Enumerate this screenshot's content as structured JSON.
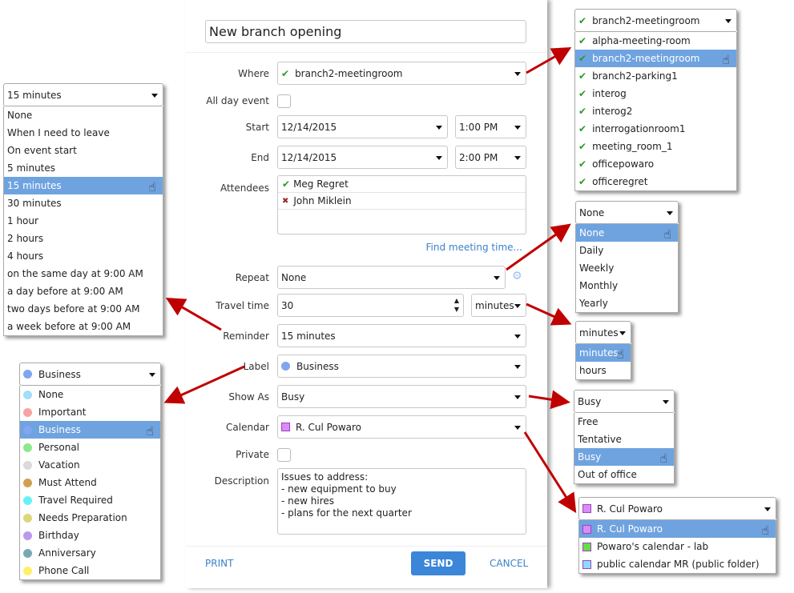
{
  "form": {
    "title": "New branch opening",
    "where_label": "Where",
    "where_value": "branch2-meetingroom",
    "allday_label": "All day event",
    "start_label": "Start",
    "start_date": "12/14/2015",
    "start_time": "1:00 PM",
    "end_label": "End",
    "end_date": "12/14/2015",
    "end_time": "2:00 PM",
    "attendees_label": "Attendees",
    "attendees": [
      {
        "name": "Meg Regret",
        "status": "accepted"
      },
      {
        "name": "John Miklein",
        "status": "declined"
      }
    ],
    "find_meeting_time": "Find meeting time...",
    "repeat_label": "Repeat",
    "repeat_value": "None",
    "travel_label": "Travel time",
    "travel_value": "30",
    "travel_unit": "minutes",
    "reminder_label": "Reminder",
    "reminder_value": "15 minutes",
    "label_label": "Label",
    "label_value": "Business",
    "showas_label": "Show As",
    "showas_value": "Busy",
    "calendar_label": "Calendar",
    "calendar_value": "R. Cul Powaro",
    "private_label": "Private",
    "description_label": "Description",
    "description_lines": [
      "Issues to address:",
      "- new equipment to buy",
      "- new hires",
      "- plans for the next quarter"
    ],
    "print": "PRINT",
    "send": "SEND",
    "cancel": "CANCEL"
  },
  "colors": {
    "accent": "#3b86d8",
    "selected": "#6fa3e0",
    "arrow": "#c00000",
    "check": "#2a9a2a",
    "decline": "#9a2a2a"
  },
  "dropdowns": {
    "where": {
      "value": "branch2-meetingroom",
      "selected": 1,
      "icon": "check",
      "items": [
        "alpha-meeting-room",
        "branch2-meetingroom",
        "branch2-parking1",
        "interog",
        "interog2",
        "interrogationroom1",
        "meeting_room_1",
        "officepowaro",
        "officeregret"
      ]
    },
    "reminder": {
      "value": "15 minutes",
      "selected": 4,
      "items": [
        "None",
        "When I need to leave",
        "On event start",
        "5 minutes",
        "15 minutes",
        "30 minutes",
        "1 hour",
        "2 hours",
        "4 hours",
        "on the same day at 9:00 AM",
        "a day before at 9:00 AM",
        "two days before at 9:00 AM",
        "a week before at 9:00 AM"
      ]
    },
    "repeat": {
      "value": "None",
      "selected": 0,
      "items": [
        "None",
        "Daily",
        "Weekly",
        "Monthly",
        "Yearly"
      ]
    },
    "travel_unit": {
      "value": "minutes",
      "selected": 0,
      "items": [
        "minutes",
        "hours"
      ]
    },
    "showas": {
      "value": "Busy",
      "selected": 2,
      "items": [
        "Free",
        "Tentative",
        "Busy",
        "Out of office"
      ]
    },
    "label": {
      "value": "Business",
      "value_color": "#7fa6ee",
      "selected": 2,
      "icon": "dot",
      "items": [
        {
          "text": "None",
          "color": "#a3def8"
        },
        {
          "text": "Important",
          "color": "#f7a3a3"
        },
        {
          "text": "Business",
          "color": "#7fa6ee"
        },
        {
          "text": "Personal",
          "color": "#8ee88e"
        },
        {
          "text": "Vacation",
          "color": "#dadada"
        },
        {
          "text": "Must Attend",
          "color": "#d0a050"
        },
        {
          "text": "Travel Required",
          "color": "#66f2f4"
        },
        {
          "text": "Needs Preparation",
          "color": "#dcd77a"
        },
        {
          "text": "Birthday",
          "color": "#bb99ee"
        },
        {
          "text": "Anniversary",
          "color": "#7aa8b2"
        },
        {
          "text": "Phone Call",
          "color": "#fff06a"
        }
      ]
    },
    "calendar": {
      "value": "R. Cul Powaro",
      "value_color": "#d98cf7",
      "selected": 0,
      "icon": "square",
      "items": [
        {
          "text": "R. Cul Powaro",
          "color": "#d98cf7"
        },
        {
          "text": "Powaro's calendar - lab",
          "color": "#66dd44"
        },
        {
          "text": "public calendar MR (public folder)",
          "color": "#88ddff"
        }
      ]
    }
  }
}
